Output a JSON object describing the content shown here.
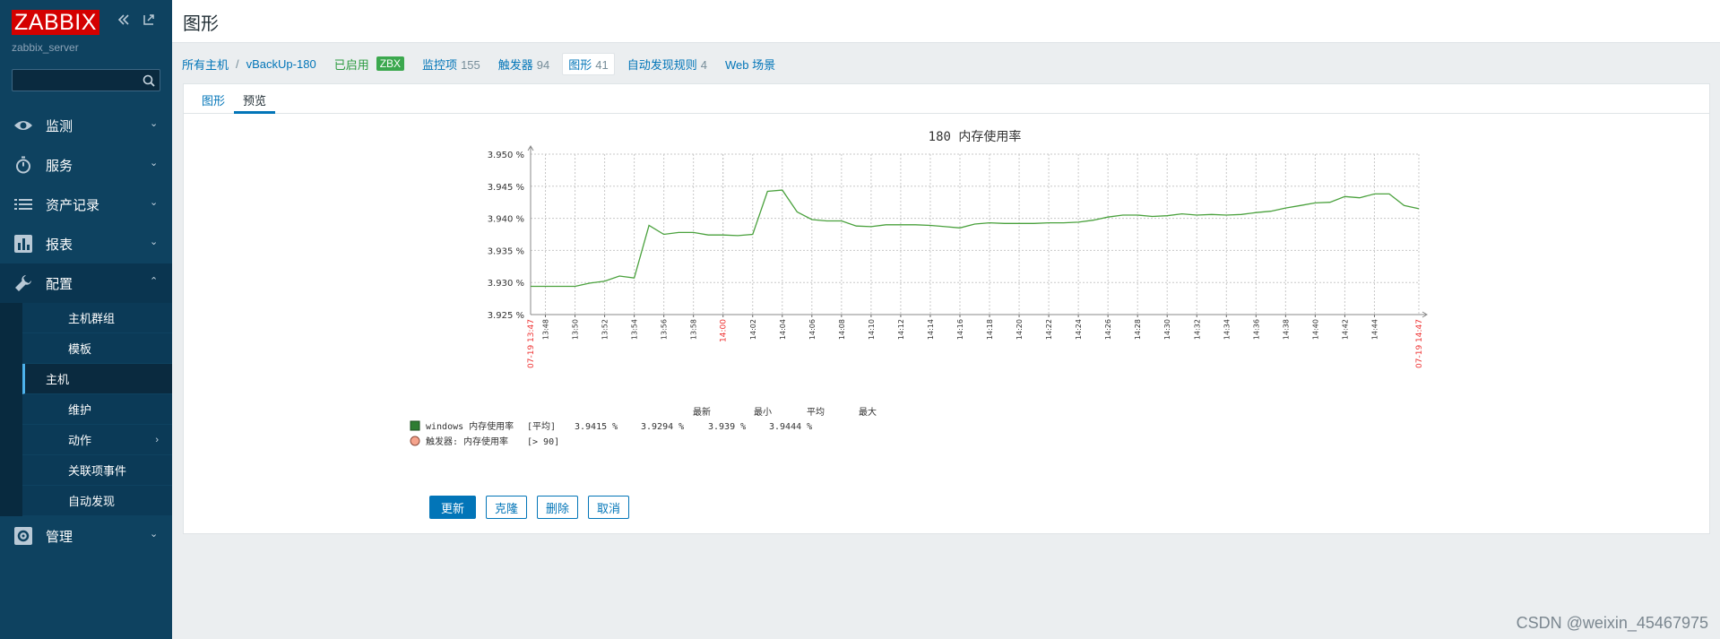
{
  "sidebar": {
    "logo": "ZABBIX",
    "server_name": "zabbix_server",
    "search_placeholder": "",
    "menu": [
      {
        "label": "监测",
        "icon": "eye-icon"
      },
      {
        "label": "服务",
        "icon": "stopwatch-icon"
      },
      {
        "label": "资产记录",
        "icon": "list-icon"
      },
      {
        "label": "报表",
        "icon": "bar-chart-icon"
      },
      {
        "label": "配置",
        "icon": "wrench-icon"
      },
      {
        "label": "管理",
        "icon": "cog-icon"
      }
    ],
    "submenu": [
      "主机群组",
      "模板",
      "主机",
      "维护",
      "动作",
      "关联项事件",
      "自动发现"
    ]
  },
  "header": {
    "title": "图形"
  },
  "breadcrumb": {
    "all_hosts": "所有主机",
    "sep": "/",
    "host": "vBackUp-180",
    "enabled": "已启用",
    "zbx": "ZBX",
    "items_label": "监控项",
    "items_count": "155",
    "triggers_label": "触发器",
    "triggers_count": "94",
    "graphs_label": "图形",
    "graphs_count": "41",
    "discovery_label": "自动发现规则",
    "discovery_count": "4",
    "web_label": "Web 场景"
  },
  "tabs": [
    "图形",
    "预览"
  ],
  "buttons": {
    "update": "更新",
    "clone": "克隆",
    "delete": "删除",
    "cancel": "取消"
  },
  "watermark": "CSDN @weixin_45467975",
  "colors": {
    "accent": "#0275b8",
    "series": "#4aa13d",
    "trigger": "#f5a38c",
    "sidebar": "#0e4260"
  },
  "chart_data": {
    "type": "line",
    "title": "180 内存使用率",
    "ylim": [
      3.925,
      3.95
    ],
    "y_ticks": [
      "3.950 %",
      "3.945 %",
      "3.940 %",
      "3.935 %",
      "3.930 %",
      "3.925 %"
    ],
    "x_tick_labels": [
      "13:48",
      "13:50",
      "13:52",
      "13:54",
      "13:56",
      "13:58",
      "14:00",
      "14:02",
      "14:04",
      "14:06",
      "14:08",
      "14:10",
      "14:12",
      "14:14",
      "14:16",
      "14:18",
      "14:20",
      "14:22",
      "14:24",
      "14:26",
      "14:28",
      "14:30",
      "14:32",
      "14:34",
      "14:36",
      "14:38",
      "14:40",
      "14:42",
      "14:44"
    ],
    "x_start_label": "07-19 13:47",
    "x_end_label": "07-19 14:47",
    "grid": true,
    "series": [
      {
        "name": "windows 内存使用率",
        "values": [
          3.9294,
          3.9294,
          3.9294,
          3.9294,
          3.9299,
          3.9302,
          3.931,
          3.9307,
          3.9389,
          3.9375,
          3.9378,
          3.9378,
          3.9374,
          3.9374,
          3.9373,
          3.9375,
          3.9442,
          3.9444,
          3.941,
          3.9398,
          3.9396,
          3.9396,
          3.9388,
          3.9387,
          3.939,
          3.939,
          3.939,
          3.9389,
          3.9387,
          3.9385,
          3.9391,
          3.9393,
          3.9392,
          3.9392,
          3.9392,
          3.9393,
          3.9393,
          3.9394,
          3.9397,
          3.9402,
          3.9405,
          3.9405,
          3.9403,
          3.9404,
          3.9407,
          3.9405,
          3.9406,
          3.9405,
          3.9406,
          3.9409,
          3.9411,
          3.9416,
          3.942,
          3.9424,
          3.9425,
          3.9434,
          3.9432,
          3.9438,
          3.9438,
          3.942,
          3.9415
        ]
      }
    ],
    "legend": {
      "headers": [
        "最新",
        "最小",
        "平均",
        "最大"
      ],
      "series_label": "windows 内存使用率",
      "series_func": "[平均]",
      "last": "3.9415 %",
      "min": "3.9294 %",
      "avg": "3.939 %",
      "max": "3.9444 %",
      "trigger_label": "触发器: 内存使用率",
      "trigger_cond": "[> 90]"
    }
  }
}
